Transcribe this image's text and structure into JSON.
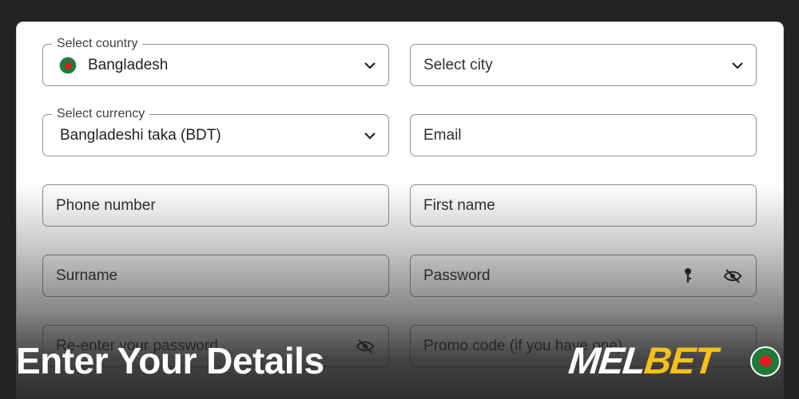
{
  "form": {
    "country": {
      "label": "Select country",
      "value": "Bangladesh"
    },
    "city": {
      "placeholder": "Select city"
    },
    "currency": {
      "label": "Select currency",
      "value": "Bangladeshi taka (BDT)"
    },
    "email": {
      "placeholder": "Email"
    },
    "phone": {
      "placeholder": "Phone number"
    },
    "first_name": {
      "placeholder": "First name"
    },
    "surname": {
      "placeholder": "Surname"
    },
    "password": {
      "placeholder": "Password"
    },
    "reenter_password": {
      "placeholder": "Re-enter your password"
    },
    "promo_code": {
      "placeholder": "Promo code (if you have one)"
    }
  },
  "overlay": {
    "headline": "Enter Your Details",
    "brand_part1": "MEL",
    "brand_part2": "BET"
  },
  "colors": {
    "background": "#232323",
    "brand_yellow": "#f7c11a",
    "flag_green": "#1d7c3a",
    "flag_red": "#e01a22"
  },
  "icons": [
    "chevron-down-icon",
    "key-icon",
    "eye-slash-icon",
    "bangladesh-flag-icon"
  ]
}
